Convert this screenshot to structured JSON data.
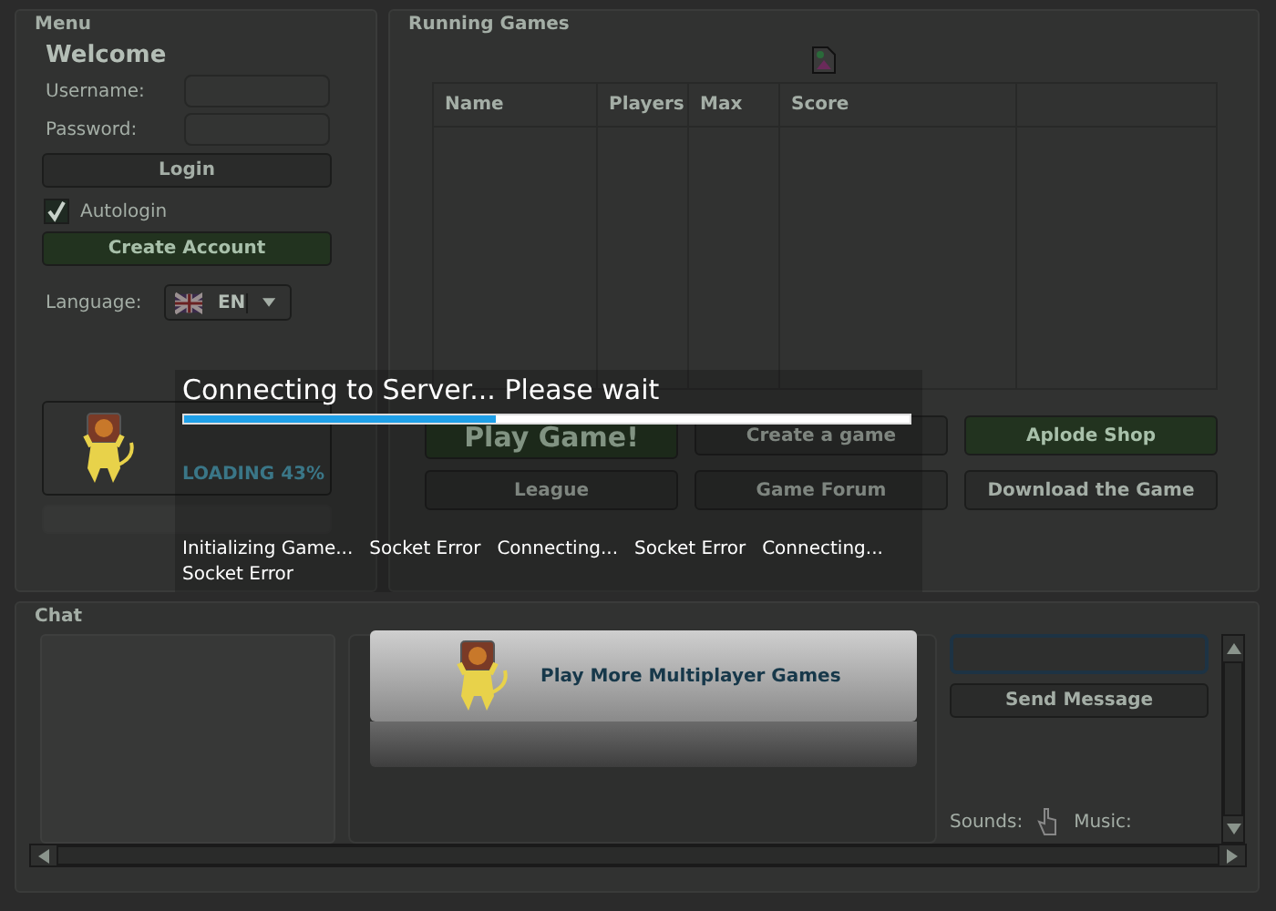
{
  "menu": {
    "title": "Menu",
    "welcome": "Welcome",
    "fields": [
      {
        "label": "Username:"
      },
      {
        "label": "Password:"
      }
    ],
    "login_button": "Login",
    "autologin": {
      "label": "Autologin",
      "checked": true
    },
    "create_account_button": "Create Account",
    "language": {
      "label": "Language:",
      "value": "EN"
    },
    "promo_card": {
      "status": "LOADING 43%"
    }
  },
  "running_games": {
    "title": "Running Games",
    "table": {
      "columns": [
        "Name",
        "Players",
        "Max",
        "Score",
        ""
      ]
    },
    "buttons": [
      {
        "label": "Play Game!",
        "kind": "primary"
      },
      {
        "label": "Create a game",
        "kind": "plain"
      },
      {
        "label": "Aplode Shop",
        "kind": "green"
      },
      {
        "label": "League",
        "kind": "plain"
      },
      {
        "label": "Game Forum",
        "kind": "plain"
      },
      {
        "label": "Download the Game",
        "kind": "plain"
      }
    ]
  },
  "chat": {
    "title": "Chat",
    "banner": "Play More Multiplayer Games",
    "send_button": "Send Message",
    "sounds_label": "Sounds:",
    "music_label": "Music:"
  },
  "loading_overlay": {
    "title": "Connecting to Server... Please wait",
    "level": 0.43,
    "messages": [
      "Initializing Game...",
      "Socket Error",
      "Connecting...",
      "Socket Error",
      "Connecting...",
      "Socket Error"
    ]
  }
}
